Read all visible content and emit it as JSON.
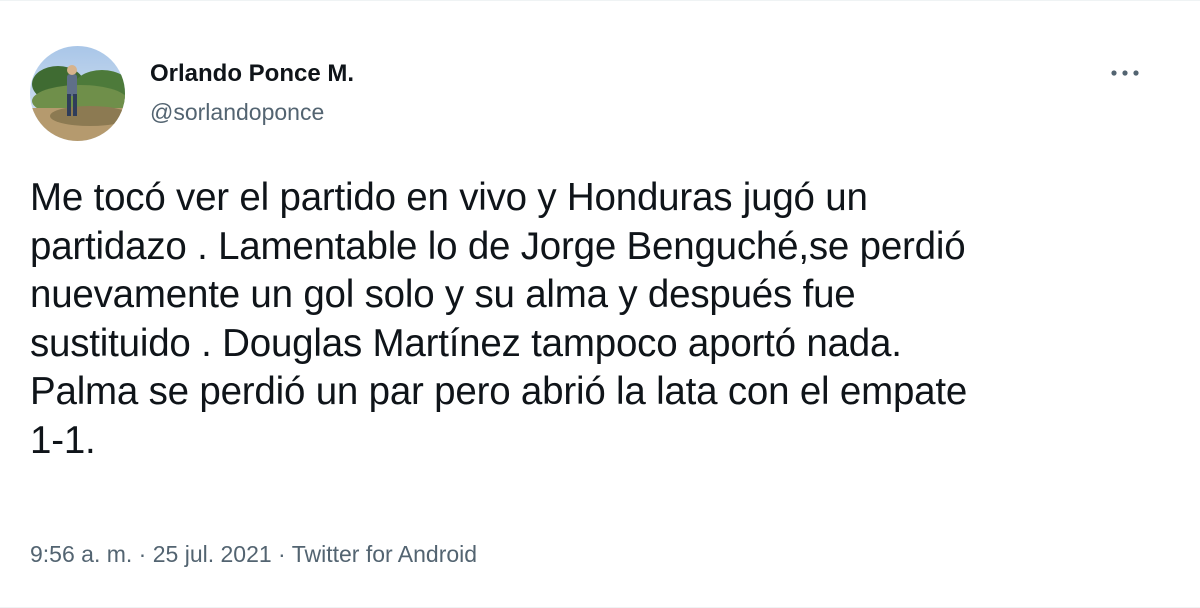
{
  "author": {
    "display_name": "Orlando Ponce M.",
    "handle": "@sorlandoponce",
    "avatar_icon": "profile-photo-person-outdoors"
  },
  "more_icon": "more-horizontal-icon",
  "tweet": {
    "text": "Me tocó ver el partido en vivo y Honduras jugó un\npartidazo . Lamentable lo de Jorge Benguché,se perdió\nnuevamente un gol solo y su alma y después fue\nsustituido . Douglas Martínez tampoco aportó nada.\nPalma se perdió un par pero abrió la lata con el empate\n1-1."
  },
  "meta": {
    "time": "9:56 a. m.",
    "separator": " · ",
    "date": "25 jul. 2021",
    "source": "Twitter for Android"
  },
  "colors": {
    "text_primary": "#0f1419",
    "text_secondary": "#536471",
    "border": "#eff3f4"
  }
}
